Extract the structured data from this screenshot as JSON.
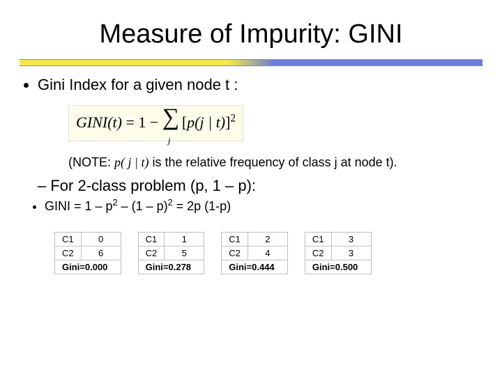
{
  "title": "Measure of Impurity: GINI",
  "bullet1": "Gini Index for a given node t :",
  "formula": {
    "lhs": "GINI(t)",
    "eq": " = 1 − ",
    "bracket_open": "[",
    "inner": "p(j | t)",
    "bracket_close": "]",
    "exp": "2",
    "sum_sub": "j"
  },
  "note_prefix": "(NOTE: ",
  "note_pjt": "p( j | t)",
  "note_suffix": " is the relative frequency of class j at node t).",
  "sub1": "For 2-class problem (p, 1 – p):",
  "sub2_html": "GINI = 1 – p",
  "sub2_mid": " – (1 – p)",
  "sub2_tail": " = 2p (1-p)",
  "labels": {
    "c1": "C1",
    "c2": "C2",
    "gini_prefix": "Gini="
  },
  "tables": [
    {
      "c1": "0",
      "c2": "6",
      "gini": "0.000"
    },
    {
      "c1": "1",
      "c2": "5",
      "gini": "0.278"
    },
    {
      "c1": "2",
      "c2": "4",
      "gini": "0.444"
    },
    {
      "c1": "3",
      "c2": "3",
      "gini": "0.500"
    }
  ]
}
